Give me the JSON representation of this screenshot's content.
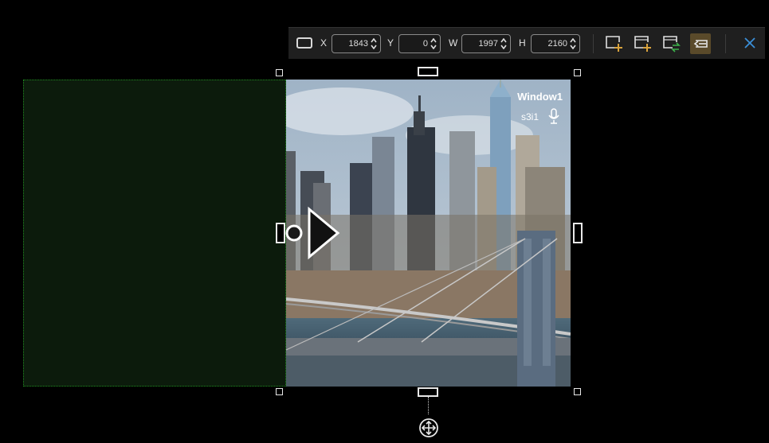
{
  "toolbar": {
    "x_label": "X",
    "x_value": "1843",
    "y_label": "Y",
    "y_value": "0",
    "w_label": "W",
    "w_value": "1997",
    "h_label": "H",
    "h_value": "2160",
    "icons": [
      "rectangle-shape-icon",
      "add-window-icon",
      "add-window-alt-icon",
      "swap-window-icon",
      "snap-align-icon",
      "close-icon"
    ],
    "accent_color": "#d8a23c",
    "close_color": "#3a8fd8"
  },
  "window": {
    "title": "Window1",
    "source": "s3i1",
    "icons": [
      "microphone-icon",
      "play-icon"
    ]
  },
  "colors": {
    "region_border": "#1f8a1f",
    "region_fill": "#0c1b0c"
  }
}
